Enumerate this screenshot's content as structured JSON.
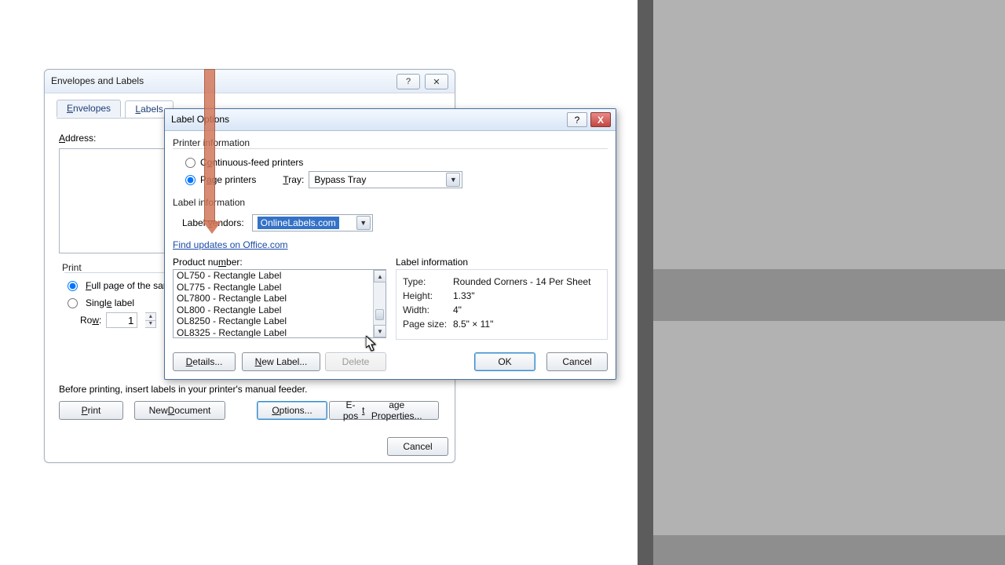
{
  "parent": {
    "title": "Envelopes and Labels",
    "tabs": {
      "envelopes": "Envelopes",
      "labels": "Labels",
      "active": "labels"
    },
    "address_label": "Address:",
    "print": {
      "group": "Print",
      "full": "Full page of the sam",
      "single": "Single label",
      "row_label": "Row:",
      "row_value": "1"
    },
    "hint": "Before printing, insert labels in your printer's manual feeder.",
    "buttons": {
      "print": "Print",
      "newdoc": "New Document",
      "options": "Options...",
      "epost": "E-postage Properties...",
      "cancel": "Cancel"
    }
  },
  "child": {
    "title": "Label Options",
    "printer_info": "Printer information",
    "printers": {
      "continuous": "Continuous-feed printers",
      "page": "Page printers",
      "selected": "page"
    },
    "tray_label": "Tray:",
    "tray_value": "Bypass Tray",
    "label_info": "Label information",
    "vendor_label": "Label vendors:",
    "vendor_value": "OnlineLabels.com",
    "updates_link": "Find updates on Office.com",
    "pn_label": "Product number:",
    "pn_items": [
      "OL750 - Rectangle Label",
      "OL775 - Rectangle Label",
      "OL7800 - Rectangle Label",
      "OL800 - Rectangle Label",
      "OL8250 - Rectangle Label",
      "OL8325 - Rectangle Label"
    ],
    "li2": {
      "title": "Label information",
      "type_k": "Type:",
      "type_v": "Rounded Corners - 14 Per Sheet",
      "height_k": "Height:",
      "height_v": "1.33\"",
      "width_k": "Width:",
      "width_v": "4\"",
      "page_k": "Page size:",
      "page_v": "8.5\" × 11\""
    },
    "buttons": {
      "details": "Details...",
      "newlabel": "New Label...",
      "delete": "Delete",
      "ok": "OK",
      "cancel": "Cancel"
    }
  }
}
